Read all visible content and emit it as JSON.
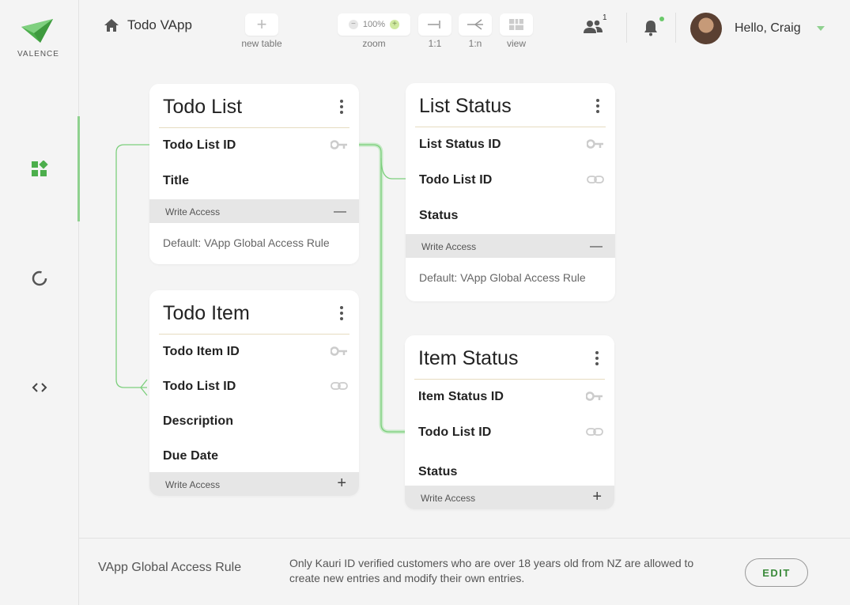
{
  "app": {
    "logo_text": "VALENCE",
    "project_name": "Todo VApp"
  },
  "toolbar": {
    "new_table_label": "new table",
    "zoom_value": "100%",
    "zoom_label": "zoom",
    "one_to_one_label": "1:1",
    "one_to_many_label": "1:n",
    "view_label": "view"
  },
  "header": {
    "users_count": "1",
    "greeting": "Hello, Craig"
  },
  "tables": {
    "todo_list": {
      "title": "Todo List",
      "fields": [
        "Todo List ID",
        "Title"
      ],
      "access_label": "Write Access",
      "access_text": "Default: VApp Global Access Rule"
    },
    "todo_item": {
      "title": "Todo Item",
      "fields": [
        "Todo Item ID",
        "Todo List ID",
        "Description",
        "Due Date"
      ],
      "access_label": "Write Access"
    },
    "list_status": {
      "title": "List Status",
      "fields": [
        "List Status ID",
        "Todo List ID",
        "Status"
      ],
      "access_label": "Write Access",
      "access_text": "Default: VApp Global Access Rule"
    },
    "item_status": {
      "title": "Item Status",
      "fields": [
        "Item Status ID",
        "Todo List ID",
        "Status"
      ],
      "access_label": "Write Access"
    }
  },
  "footer": {
    "title": "VApp Global Access Rule",
    "description": "Only Kauri ID verified customers who are over 18 years old from NZ are allowed to create new entries and modify their own entries.",
    "edit_label": "EDIT"
  },
  "colors": {
    "accent": "#8fd18f",
    "brand": "#4cae4c",
    "link_line": "#7ccf7c"
  }
}
